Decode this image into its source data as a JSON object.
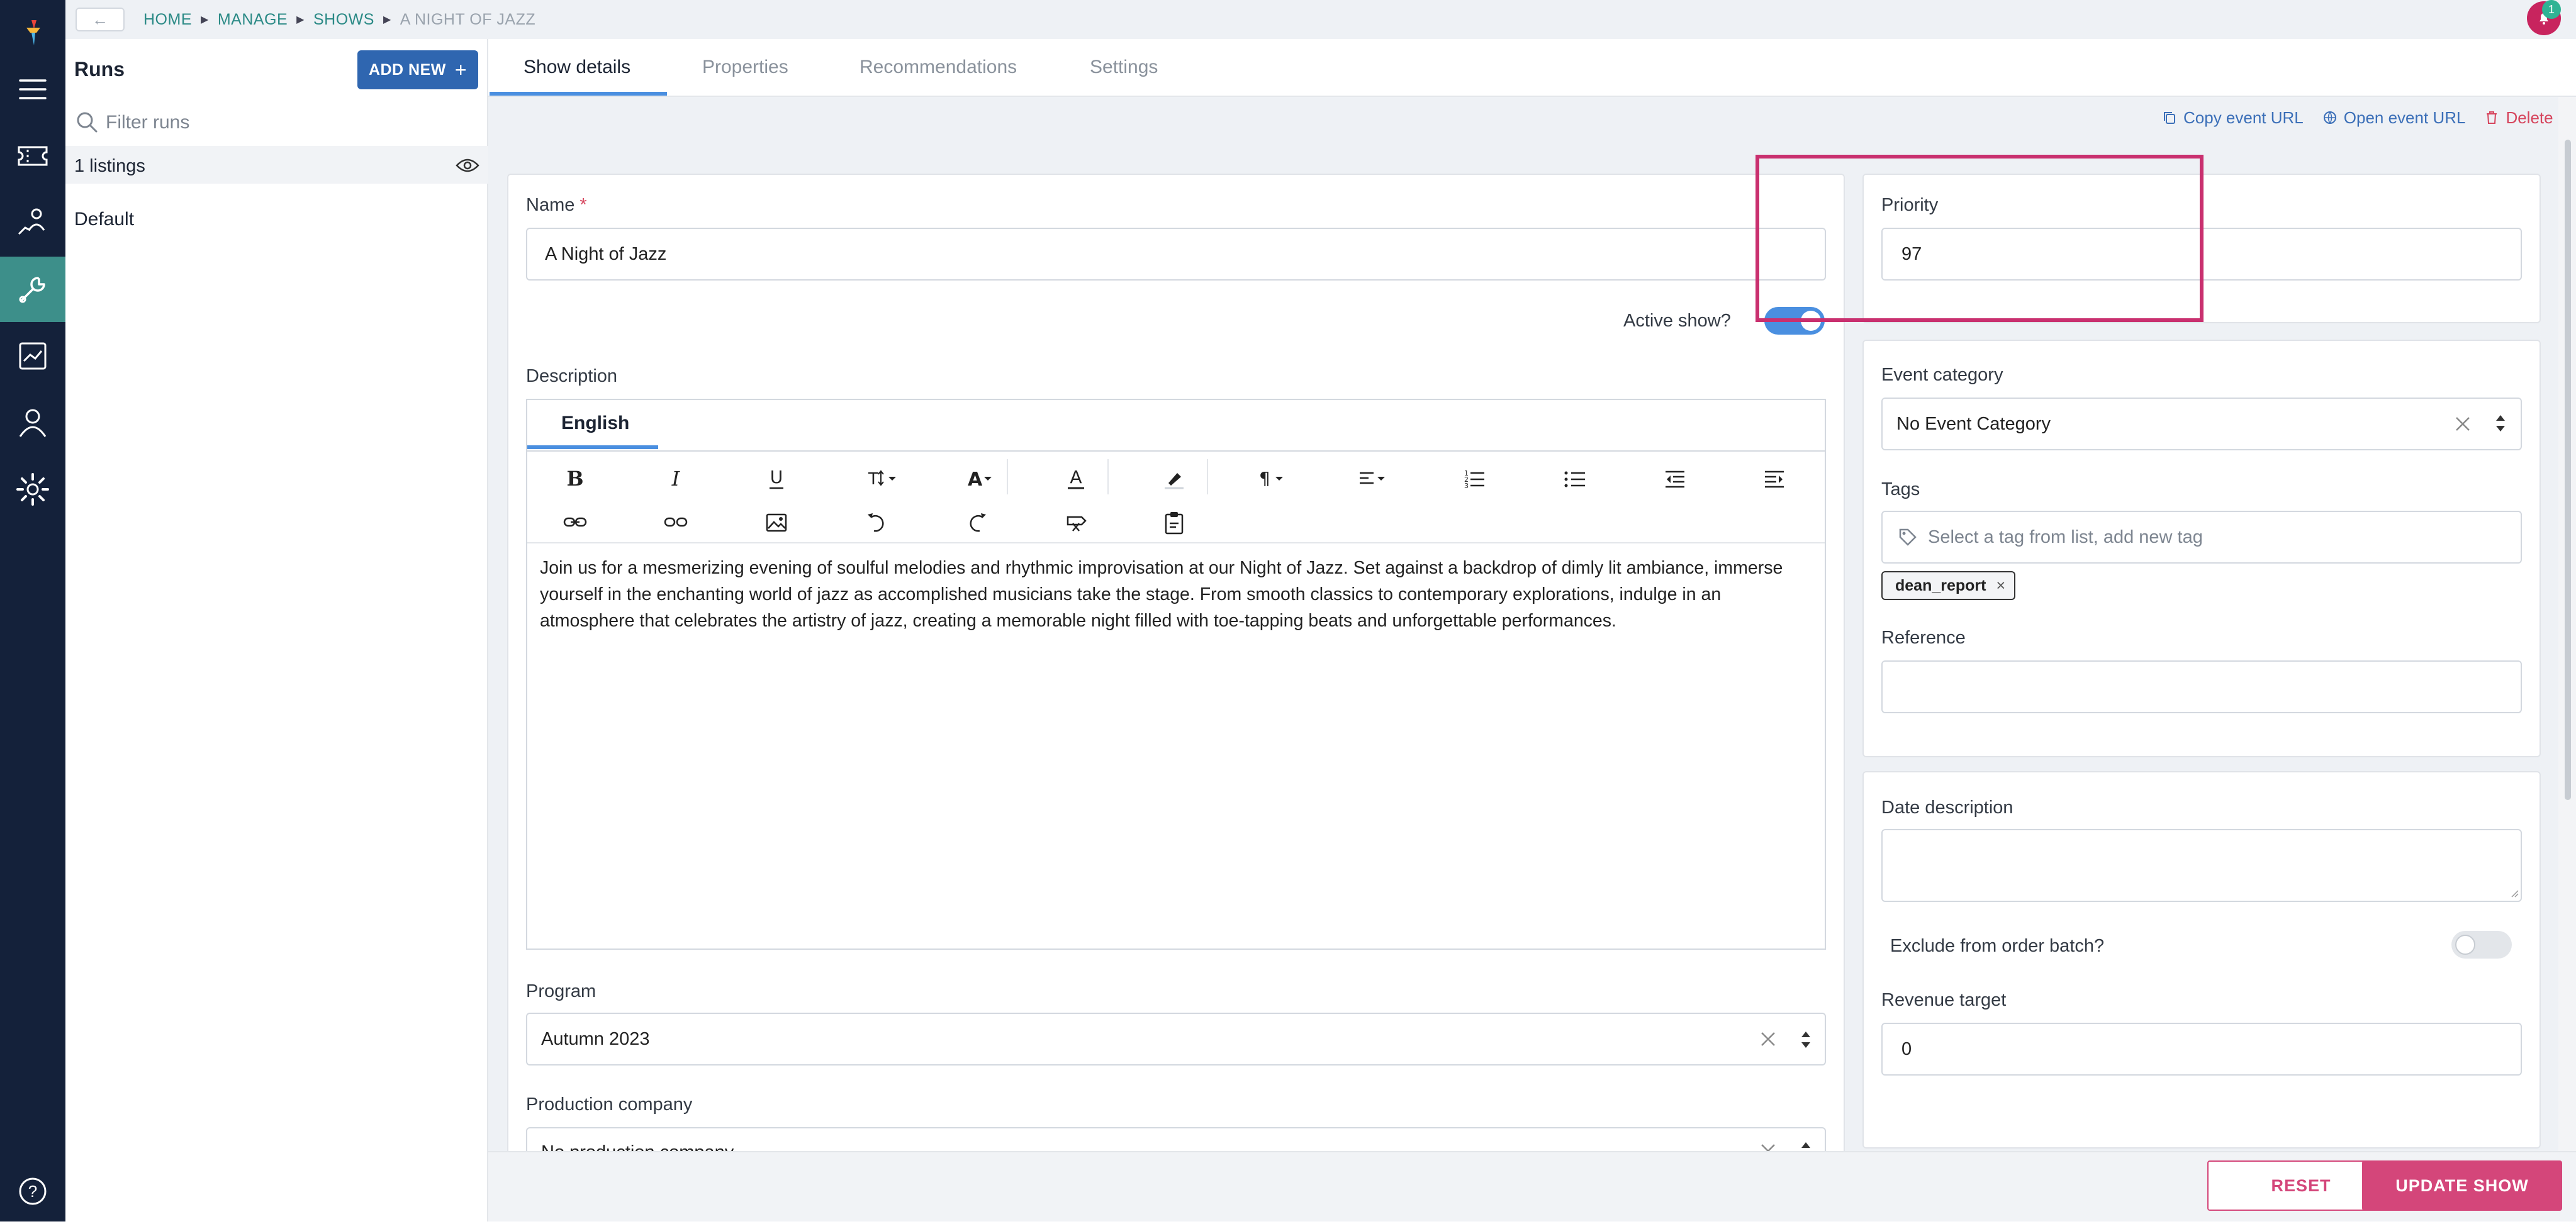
{
  "nav": {
    "icons": [
      "logo-icon",
      "menu-icon",
      "tickets-icon",
      "customers-icon",
      "tools-icon",
      "reports-icon",
      "user-icon",
      "settings-icon",
      "help-icon"
    ]
  },
  "topbar": {
    "back_label": "←",
    "breadcrumb": [
      "HOME",
      "MANAGE",
      "SHOWS",
      "A NIGHT OF JAZZ"
    ],
    "notification_count": "1"
  },
  "runs": {
    "title": "Runs",
    "add_new_label": "ADD NEW",
    "add_new_icon": "+",
    "filter_placeholder": "Filter runs",
    "listings_label": "1 listings",
    "items": [
      "Default"
    ]
  },
  "tabs": [
    "Show details",
    "Properties",
    "Recommendations",
    "Settings"
  ],
  "actions": {
    "copy_url": "Copy event URL",
    "open_url": "Open event URL",
    "delete": "Delete"
  },
  "form": {
    "name_label": "Name",
    "required_mark": "*",
    "name_value": "A Night of Jazz",
    "active_label": "Active show?",
    "active_on": true,
    "description_label": "Description",
    "language_tab": "English",
    "description_text": "Join us for a mesmerizing evening of soulful melodies and rhythmic improvisation at our Night of Jazz. Set against a backdrop of dimly lit ambiance, immerse yourself in the enchanting world of jazz as accomplished musicians take the stage. From smooth classics to contemporary explorations, indulge in an atmosphere that celebrates the artistry of jazz, creating a memorable night filled with toe-tapping beats and unforgettable performances.",
    "program_label": "Program",
    "program_value": "Autumn 2023",
    "production_label": "Production company",
    "production_value": "No production company",
    "priority_label": "Priority",
    "priority_value": "97",
    "event_category_label": "Event category",
    "event_category_value": "No Event Category",
    "tags_label": "Tags",
    "tags_placeholder": "Select a tag from list, add new tag",
    "tags": [
      "dean_report"
    ],
    "reference_label": "Reference",
    "reference_value": "",
    "date_description_label": "Date description",
    "date_description_value": "",
    "exclude_label": "Exclude from order batch?",
    "exclude_on": false,
    "revenue_label": "Revenue target",
    "revenue_value": "0"
  },
  "footer": {
    "reset_label": "RESET",
    "update_label": "UPDATE SHOW"
  },
  "colors": {
    "nav_bg": "#14213a",
    "nav_active": "#3d8f8a",
    "accent_blue": "#2f66b0",
    "link_teal": "#2b8a86",
    "primary_pink": "#d4467a",
    "highlight": "#c9306f",
    "toggle_on": "#4a8fe0"
  }
}
